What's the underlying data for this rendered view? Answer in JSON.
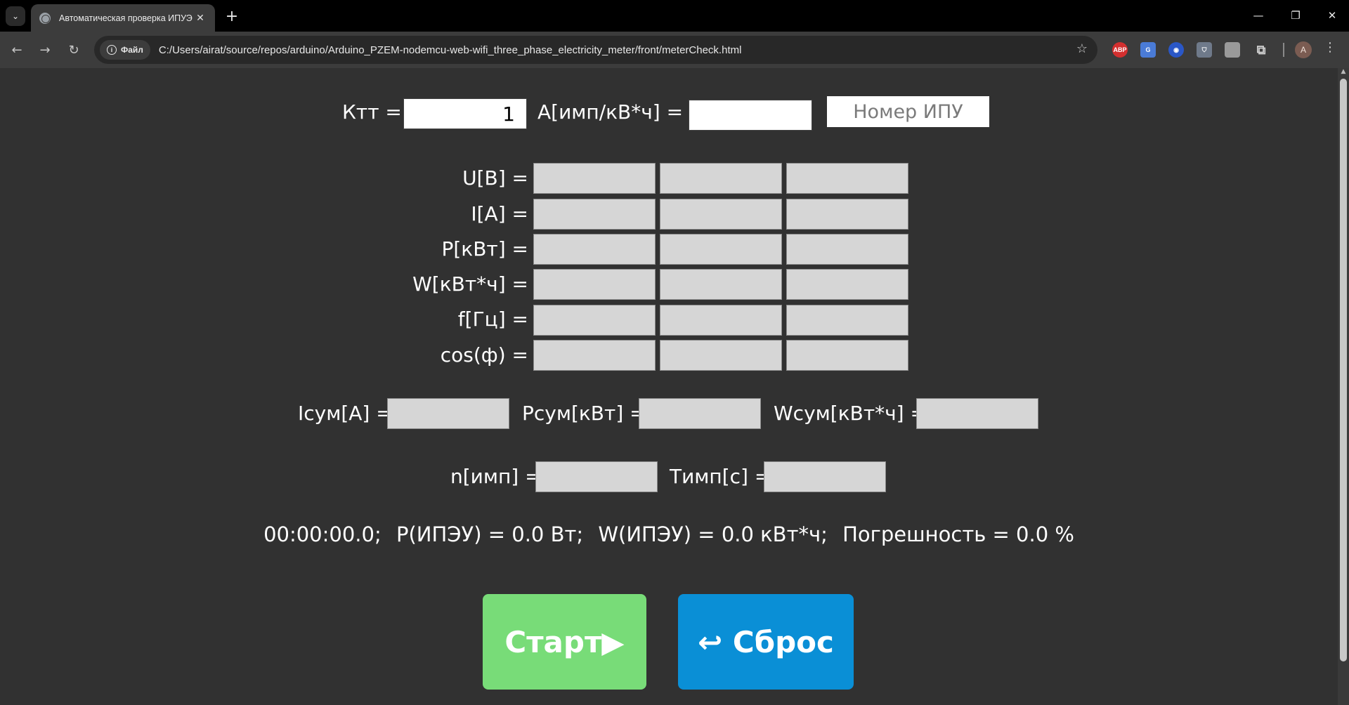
{
  "browser": {
    "tab_title": "Автоматическая проверка ИПУЭ",
    "site_chip": "Файл",
    "url": "C:/Users/airat/source/repos/arduino/Arduino_PZEM-nodemcu-web-wifi_three_phase_electricity_meter/front/meterCheck.html",
    "avatar_letter": "A",
    "ext_abp": "ABP"
  },
  "params": {
    "ktt_label": "Ктт =",
    "ktt_value": "1",
    "a_label": "А[имп/кВ*ч] =",
    "a_value": "",
    "meter_placeholder": "Номер ИПУ"
  },
  "measurements": {
    "rows": [
      {
        "label": "U[В] ="
      },
      {
        "label": "I[А] ="
      },
      {
        "label": "P[кВт] ="
      },
      {
        "label": "W[кВт*ч] ="
      },
      {
        "label": "f[Гц] ="
      },
      {
        "label": "cos(ф) ="
      }
    ]
  },
  "sums": {
    "i_label": "Iсум[А] =",
    "p_label": "Pсум[кВт] =",
    "w_label": "Wсум[кВт*ч] ="
  },
  "pulses": {
    "n_label": "n[имп] =",
    "t_label": "Тимп[с] ="
  },
  "status": {
    "time": "00:00:00.0;",
    "power": "P(ИПЭУ) = 0.0 Вт;",
    "energy": "W(ИПЭУ) = 0.0 кВт*ч;",
    "error": "Погрешность = 0.0 %"
  },
  "buttons": {
    "start": "Старт▶",
    "reset": "↩ Сброс"
  },
  "colors": {
    "start": "#78dc78",
    "reset": "#0a8fd6",
    "background": "#313131"
  }
}
